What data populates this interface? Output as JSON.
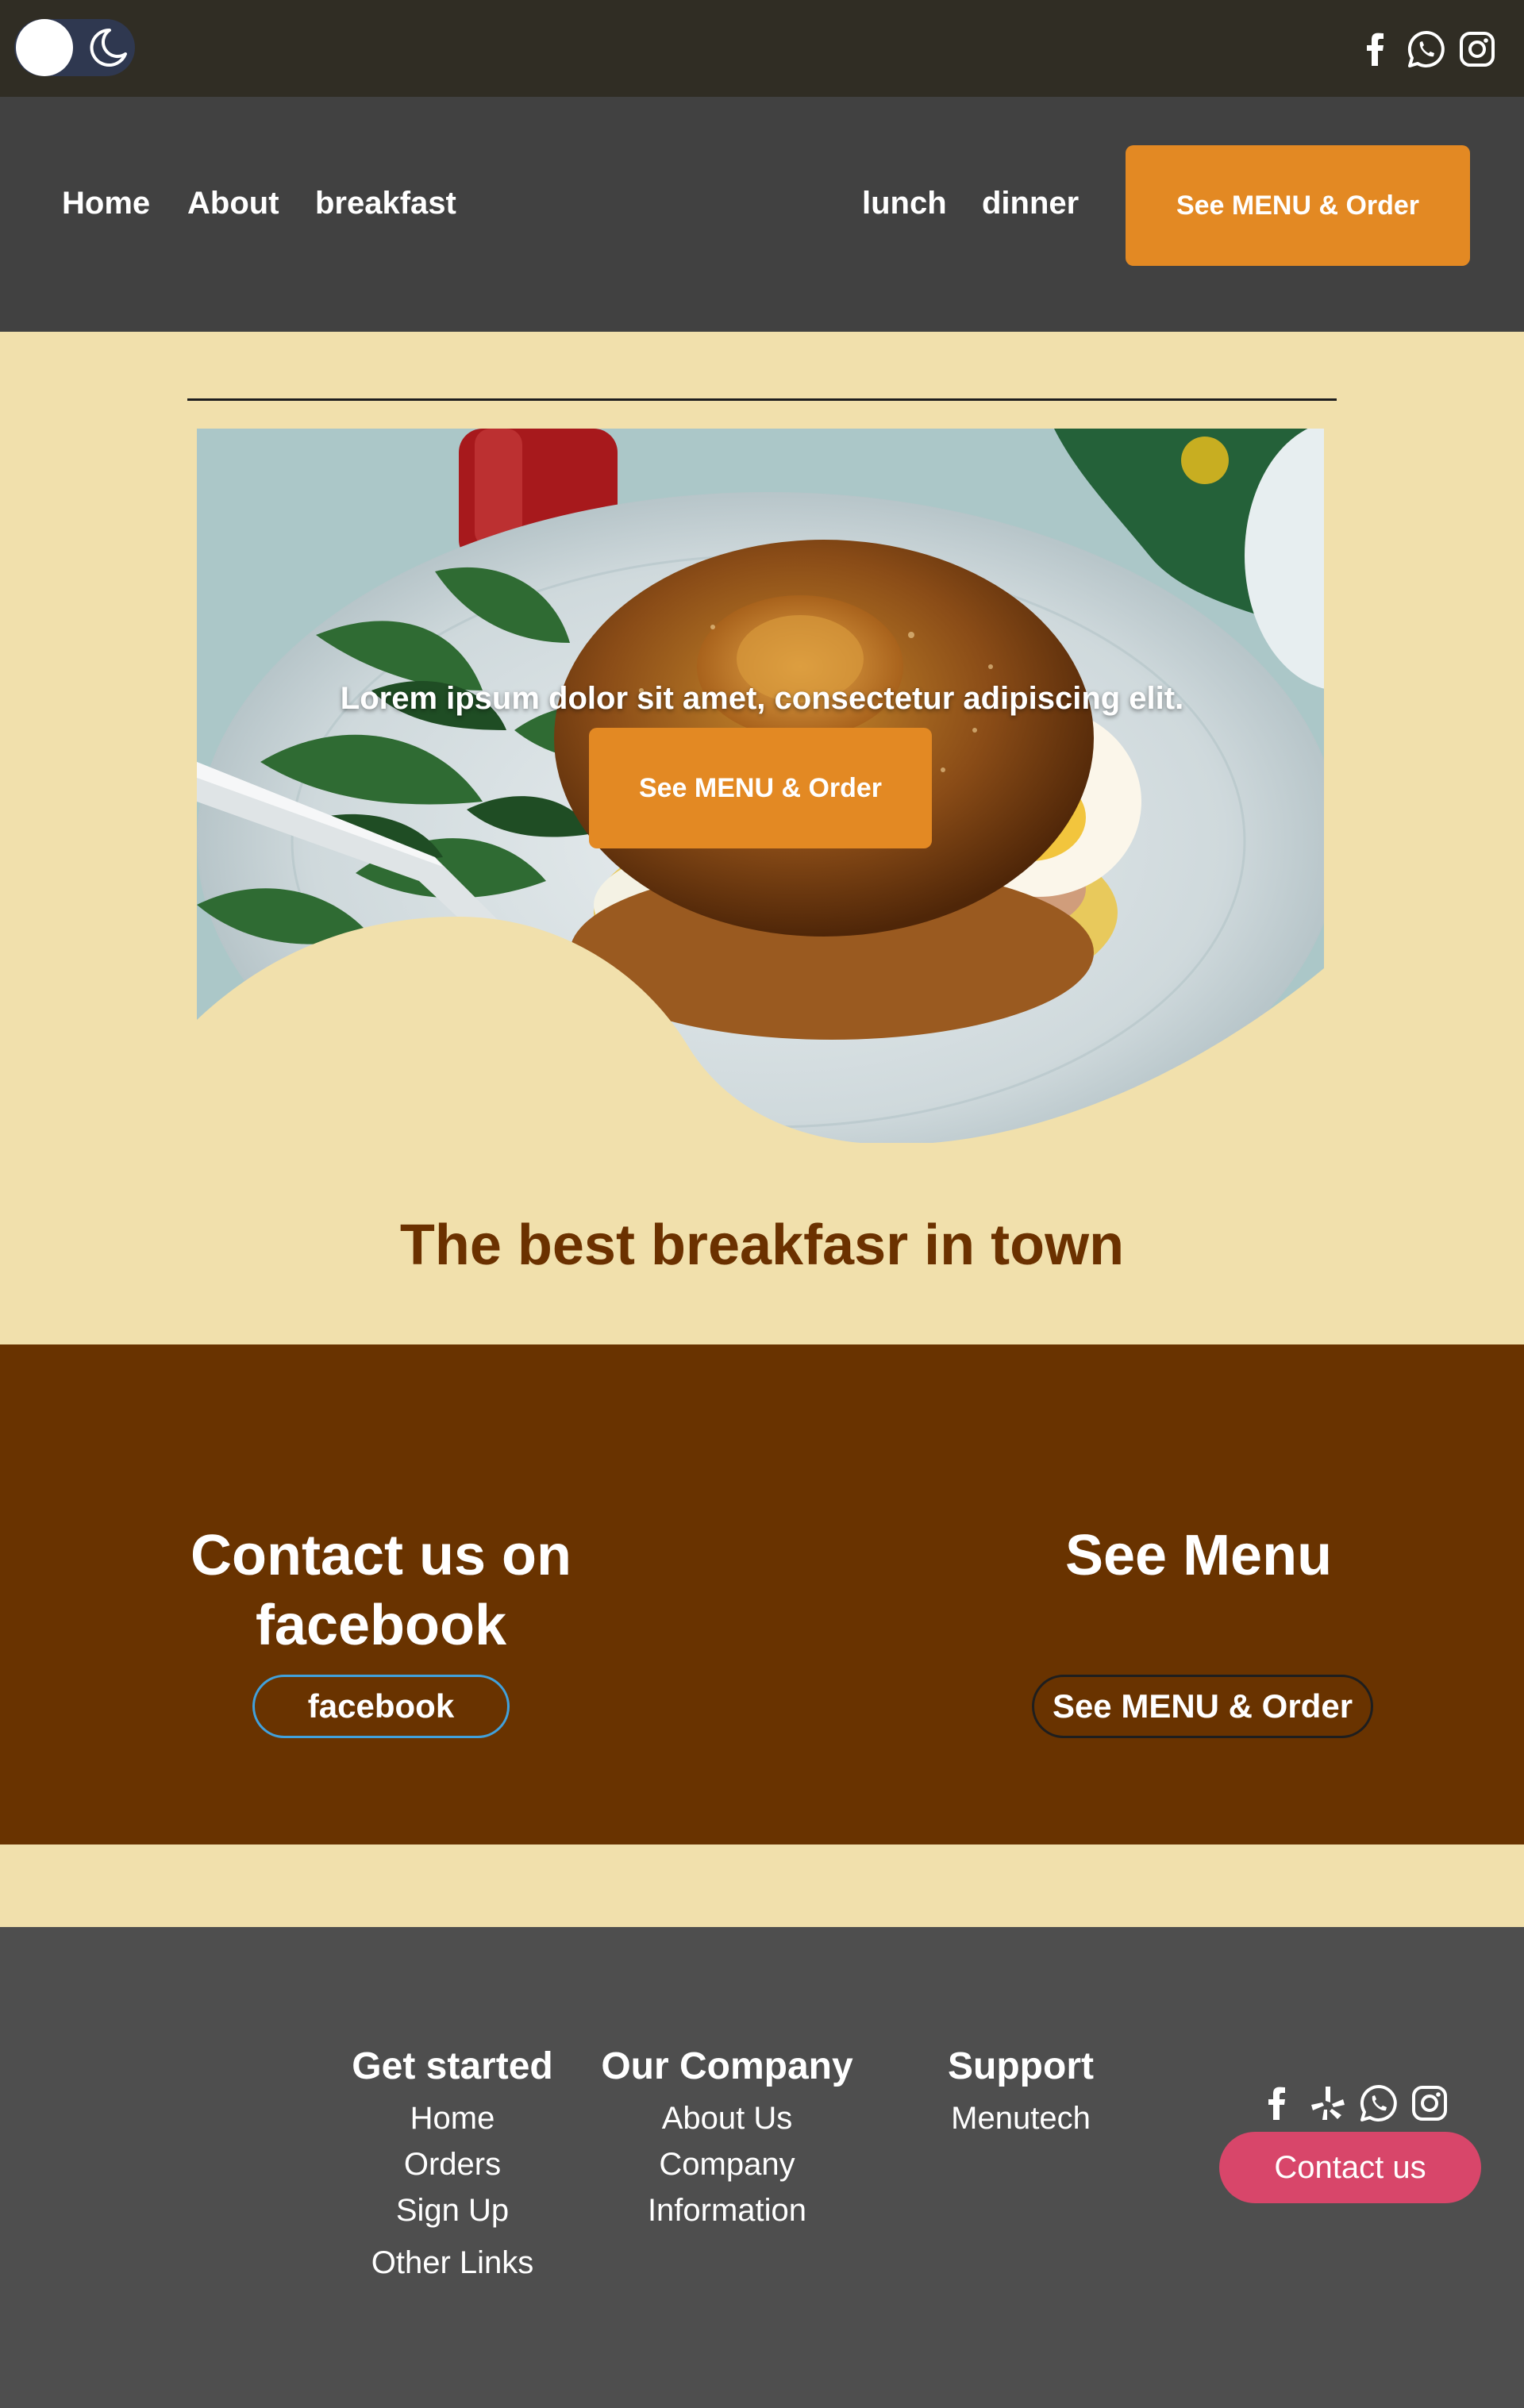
{
  "colors": {
    "topbar": "#302d24",
    "nav": "#414141",
    "cream": "#f1e0ac",
    "accent_orange": "#e38923",
    "brown": "#693300",
    "footer": "#4e4e4e",
    "contact_pink": "#d8466a",
    "facebook_outline": "#41a1dc"
  },
  "topbar": {
    "theme_toggle_icons": [
      "sun-circle-icon",
      "moon-icon"
    ],
    "social_icons": [
      "facebook-icon",
      "whatsapp-icon",
      "instagram-icon"
    ]
  },
  "nav": {
    "links": [
      "Home",
      "About",
      "breakfast",
      "lunch",
      "dinner"
    ],
    "cta_label": "See MENU & Order"
  },
  "hero": {
    "text": "Lorem ipsum dolor sit amet, consectetur adipiscing elit.",
    "cta_label": "See MENU & Order",
    "tagline": "The best breakfasr in town"
  },
  "contact": {
    "facebook_heading_line1": "Contact us on",
    "facebook_heading_line2": "facebook",
    "facebook_button": "facebook",
    "menu_heading": "See Menu",
    "menu_button": "See MENU & Order"
  },
  "footer": {
    "columns": [
      {
        "heading": "Get started",
        "items": [
          "Home",
          "Orders",
          "Sign Up",
          "Other Links"
        ]
      },
      {
        "heading": "Our Company",
        "items": [
          "About Us",
          "Company",
          "Information"
        ]
      },
      {
        "heading": "Support",
        "items": [
          "Menutech"
        ]
      }
    ],
    "social_icons": [
      "facebook-icon",
      "yelp-icon",
      "whatsapp-icon",
      "instagram-icon"
    ],
    "contact_button": "Contact us"
  }
}
